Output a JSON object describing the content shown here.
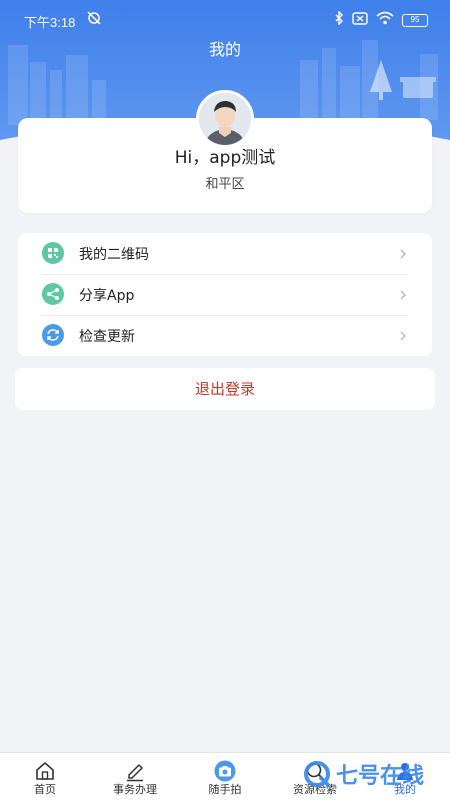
{
  "status_bar": {
    "time": "下午3:18",
    "battery": "95"
  },
  "header": {
    "title": "我的"
  },
  "profile": {
    "greeting": "Hi，app测试",
    "district": "和平区"
  },
  "menu": {
    "items": [
      {
        "label": "我的二维码",
        "icon": "qrcode-icon",
        "color": "#5cc9a0"
      },
      {
        "label": "分享App",
        "icon": "share-icon",
        "color": "#5cc9a0"
      },
      {
        "label": "检查更新",
        "icon": "refresh-icon",
        "color": "#4a9ae8"
      }
    ]
  },
  "logout_label": "退出登录",
  "tabbar": {
    "items": [
      {
        "label": "首页",
        "icon": "home-icon"
      },
      {
        "label": "事务办理",
        "icon": "edit-icon"
      },
      {
        "label": "随手拍",
        "icon": "camera-icon"
      },
      {
        "label": "资源检索",
        "icon": "search-icon"
      },
      {
        "label": "我的",
        "icon": "user-icon"
      }
    ]
  },
  "watermark": "七号在线",
  "colors": {
    "primary": "#3d7ee8",
    "logout": "#c0392b",
    "background": "#f2f3f7"
  }
}
